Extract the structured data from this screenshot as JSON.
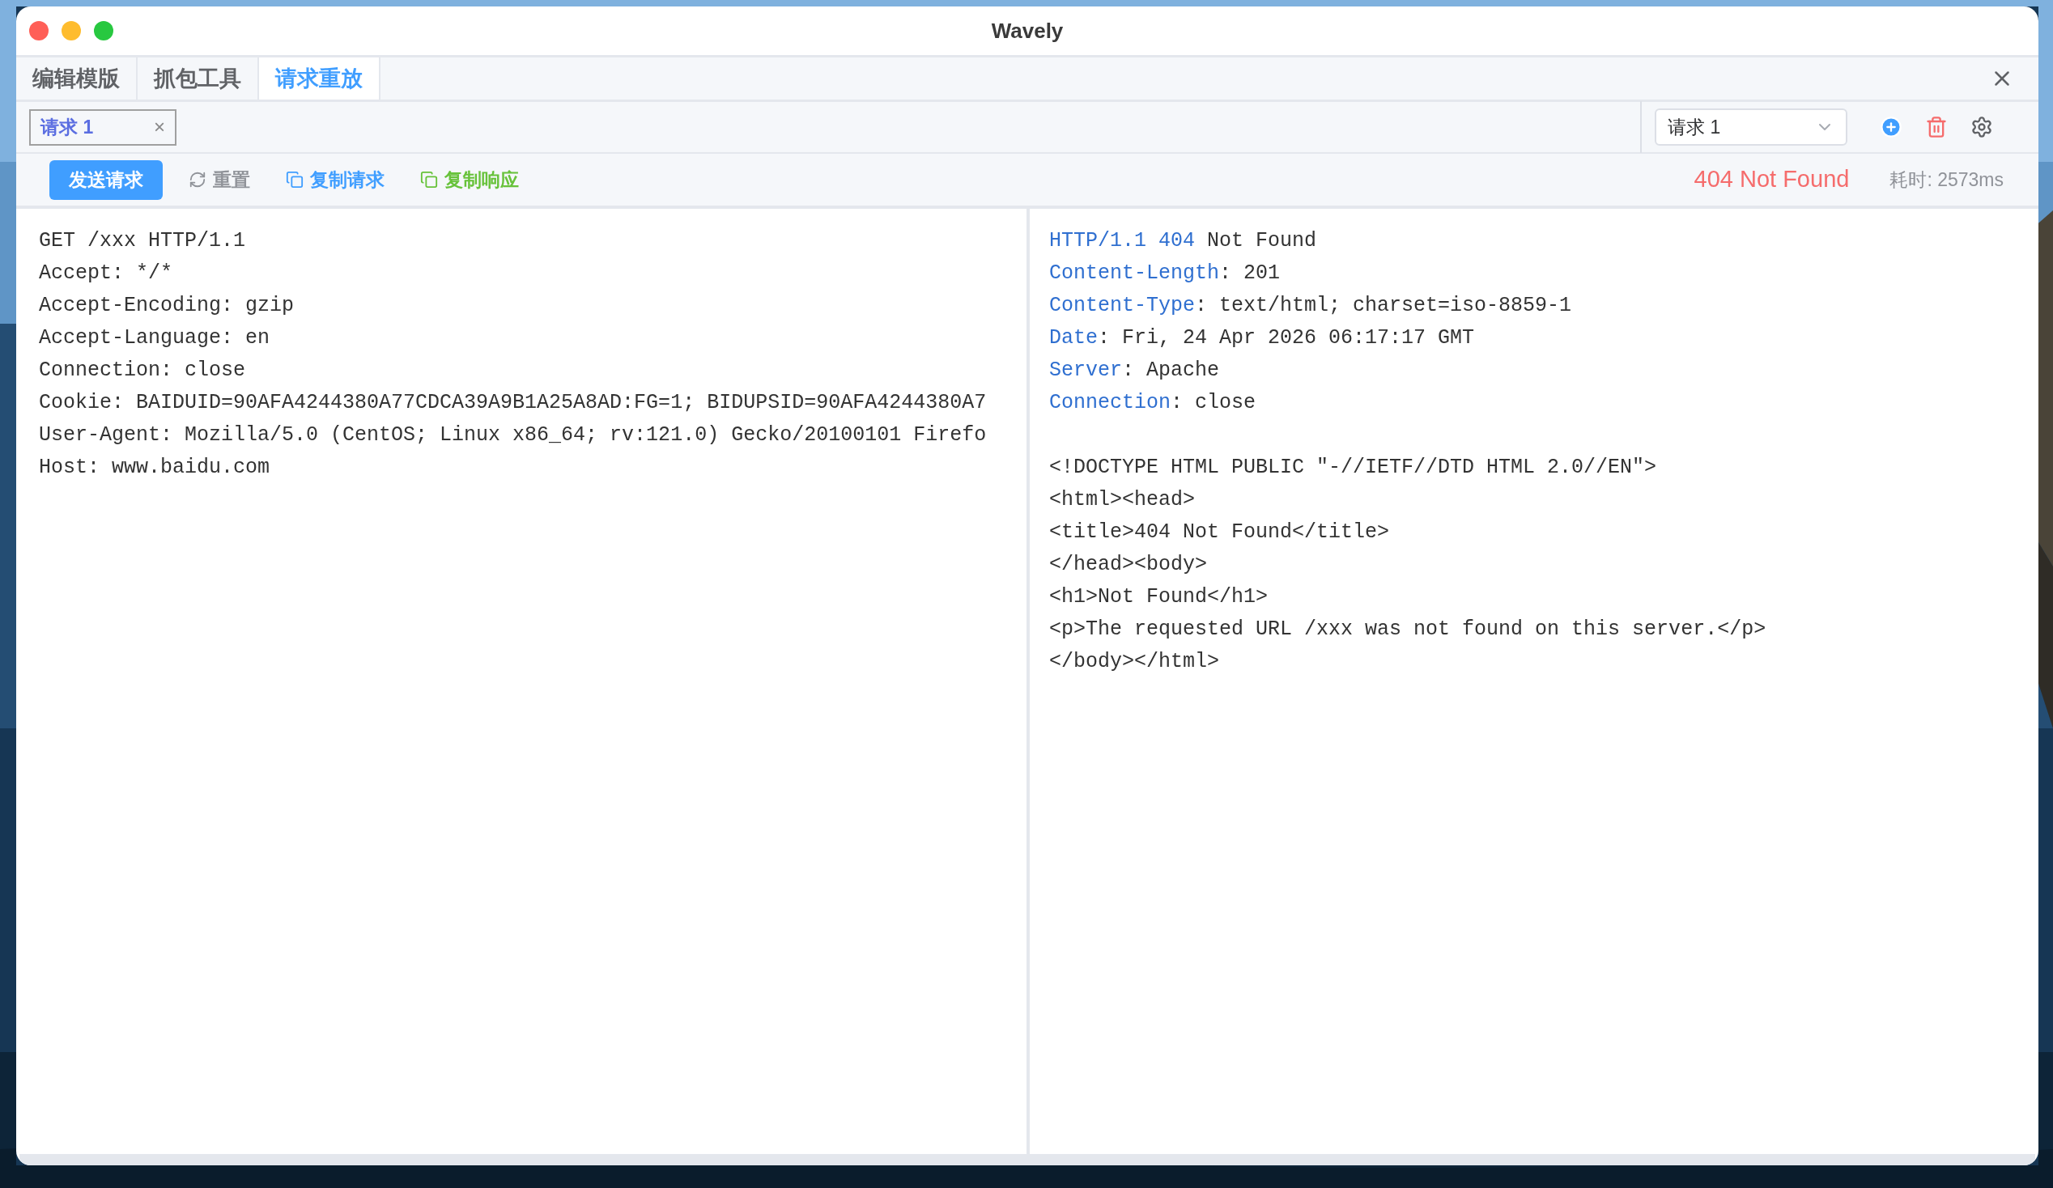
{
  "window": {
    "title": "Wavely"
  },
  "tabs": [
    {
      "label": "编辑模版",
      "selected": false
    },
    {
      "label": "抓包工具",
      "selected": false
    },
    {
      "label": "请求重放",
      "selected": true
    }
  ],
  "request_tabs": [
    {
      "label": "请求 1",
      "close": "×",
      "selected": true
    }
  ],
  "request_select": {
    "value": "请求 1"
  },
  "toolbar": [
    {
      "label": "发送请求",
      "kind": "primary"
    },
    {
      "label": "重置",
      "kind": "reset"
    },
    {
      "label": "复制请求",
      "kind": "copy-info"
    },
    {
      "label": "复制响应",
      "kind": "copy-success"
    }
  ],
  "status": {
    "text": "404 Not Found",
    "elapsed": "耗时: 2573ms"
  },
  "request_lines": [
    "GET /xxx HTTP/1.1",
    "Accept: */*",
    "Accept-Encoding: gzip",
    "Accept-Language: en",
    "Connection: close",
    "Cookie: BAIDUID=90AFA4244380A77CDCA39A9B1A25A8AD:FG=1; BIDUPSID=90AFA4244380A7",
    "User-Agent: Mozilla/5.0 (CentOS; Linux x86_64; rv:121.0) Gecko/20100101 Firefo",
    "Host: www.baidu.com"
  ],
  "response": {
    "status_line": {
      "protocol": "HTTP/1.1 404",
      "reason": "Not Found"
    },
    "headers": [
      {
        "name": "Content-Length",
        "separator": ":",
        "value": "201"
      },
      {
        "name": "Content-Type",
        "separator": ":",
        "value": "text/html; charset=iso-8859-1"
      },
      {
        "name": "Date",
        "separator": ":",
        "value": "Fri, 24 Apr 2026 06:17:17 GMT"
      },
      {
        "name": "Server",
        "separator": ":",
        "value": "Apache"
      },
      {
        "name": "Connection",
        "separator": ":",
        "value": "close"
      }
    ],
    "body_lines": [
      "<!DOCTYPE HTML PUBLIC \"-//IETF//DTD HTML 2.0//EN\">",
      "<html><head>",
      "<title>404 Not Found</title>",
      "</head><body>",
      "<h1>Not Found</h1>",
      "<p>The requested URL /xxx was not found on this server.</p>",
      "</body></html>"
    ]
  }
}
